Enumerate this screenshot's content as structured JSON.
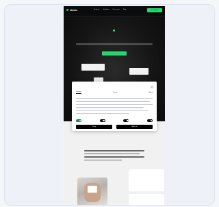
{
  "nav": {
    "logo_text": "ubuntu",
    "links": [
      "Products",
      "Solutions",
      "Use cases",
      "Blog"
    ],
    "cta_label": "Get Started"
  },
  "consent_modal": {
    "tabs": [
      "Consent",
      "Details",
      "About"
    ],
    "close_icon": "close-icon",
    "toggles": [
      true,
      false,
      false,
      false
    ],
    "buttons": [
      "Deny",
      "Allow all"
    ]
  },
  "colors": {
    "hero_bg": "#111111",
    "accent_green": "#25d86d",
    "modal_bg": "#ffffff",
    "button_black": "#000000"
  }
}
